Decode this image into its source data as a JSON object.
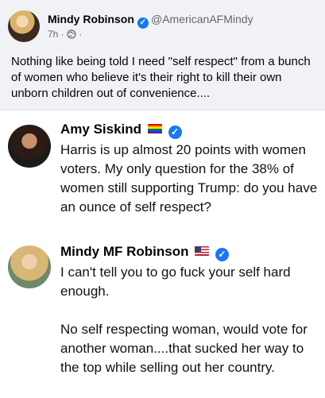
{
  "post": {
    "author_name": "Mindy Robinson",
    "verified_mark": "✓",
    "handle": "@AmericanAFMindy",
    "time": "7h",
    "separator": "·",
    "audience_icon": "public-globe-icon",
    "text": "Nothing like being told I need \"self respect\" from a bunch of women who believe it's their right to kill their own unborn children out of convenience...."
  },
  "quoted": [
    {
      "name": "Amy Siskind",
      "flag_icon": "rainbow-flag-icon",
      "verified_mark": "✓",
      "text": "Harris is up almost 20 points with women voters. My only question for the 38% of women still supporting Trump:  do you have an ounce of self respect?"
    },
    {
      "name": "Mindy MF Robinson",
      "flag_icon": "us-flag-icon",
      "verified_mark": "✓",
      "text_1": "I can't tell you to go fuck your self hard enough.",
      "text_2": "No self respecting woman, would vote for another woman....that sucked her way to the top while selling out her country."
    }
  ],
  "colors": {
    "verified": "#1877f2",
    "page_bg": "#f0f2f5",
    "card_bg": "#ffffff",
    "secondary_text": "#65676b"
  }
}
